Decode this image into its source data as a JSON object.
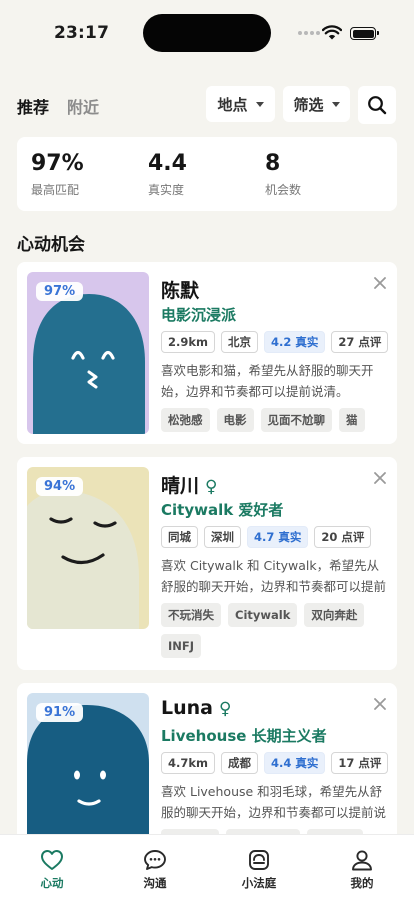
{
  "status": {
    "time": "23:17"
  },
  "header": {
    "tabs": [
      {
        "label": "推荐",
        "active": true
      },
      {
        "label": "附近",
        "active": false
      }
    ],
    "filters": {
      "location_label": "地点",
      "filter_label": "筛选"
    },
    "icons": {
      "search": "search-icon"
    }
  },
  "stats": [
    {
      "value": "97%",
      "label": "最高匹配"
    },
    {
      "value": "4.4",
      "label": "真实度"
    },
    {
      "value": "8",
      "label": "机会数"
    }
  ],
  "section": {
    "title": "心动机会"
  },
  "cards": [
    {
      "match": "97%",
      "name": "陈默",
      "gender": "",
      "subtitle": "电影沉浸派",
      "chips": [
        "2.9km",
        "北京"
      ],
      "rating": "4.2 真实",
      "reviews": "27 点评",
      "bio": "喜欢电影和猫，希望先从舒服的聊天开始，边界和节奏都可以提前说清。",
      "tags": [
        "松弛感",
        "电影",
        "见面不尬聊",
        "猫"
      ],
      "avatar_colors": {
        "bg": "#d7c6ec",
        "body": "#246f8f"
      }
    },
    {
      "match": "94%",
      "name": "晴川",
      "gender": "♀",
      "subtitle": "Citywalk 爱好者",
      "chips": [
        "同城",
        "深圳"
      ],
      "rating": "4.7 真实",
      "reviews": "20 点评",
      "bio": "喜欢 Citywalk 和 Citywalk，希望先从舒服的聊天开始，边界和节奏都可以提前说清。",
      "tags": [
        "不玩消失",
        "Citywalk",
        "双向奔赴",
        "INFJ"
      ],
      "avatar_colors": {
        "bg": "#ebe3b8",
        "body": "#e5e6d2"
      }
    },
    {
      "match": "91%",
      "name": "Luna",
      "gender": "♀",
      "subtitle": "Livehouse 长期主义者",
      "chips": [
        "4.7km",
        "成都"
      ],
      "rating": "4.4 真实",
      "reviews": "17 点评",
      "bio": "喜欢 Livehouse 和羽毛球，希望先从舒服的聊天开始，边界和节奏都可以提前说清。",
      "tags": [],
      "avatar_colors": {
        "bg": "#cfe0ef",
        "body": "#175d82"
      }
    }
  ],
  "nav": [
    {
      "label": "心动",
      "icon": "heart-icon",
      "active": true
    },
    {
      "label": "沟通",
      "icon": "chat-icon",
      "active": false
    },
    {
      "label": "小法庭",
      "icon": "court-icon",
      "active": false
    },
    {
      "label": "我的",
      "icon": "profile-icon",
      "active": false
    }
  ],
  "colors": {
    "accent": "#1b7a62",
    "rating_blue": "#2f6fd0",
    "background": "#f5f4ef"
  }
}
